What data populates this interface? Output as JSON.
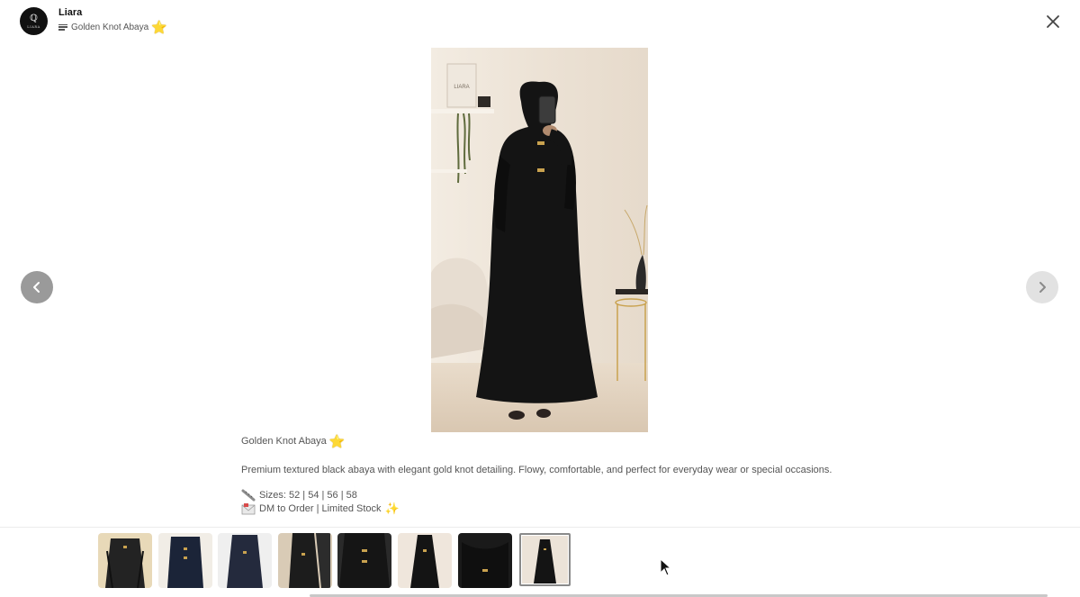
{
  "header": {
    "brand_name": "Liara",
    "avatar_glyph": "ℚ",
    "avatar_text": "LIARA",
    "subtitle": "Golden Knot Abaya",
    "subtitle_star": "⭐",
    "close_icon": "close-icon",
    "menu_icon": "menu-lines-icon"
  },
  "image": {
    "wall_sign": "LIARA"
  },
  "navigation": {
    "prev_icon": "chevron-left-icon",
    "next_icon": "chevron-right-icon"
  },
  "caption": {
    "title": "Golden Knot Abaya",
    "title_star": "⭐",
    "description": "Premium textured black abaya with elegant gold knot detailing. Flowy, comfortable, and perfect for everyday wear or special occasions.",
    "sizes": "Sizes: 52 | 54 | 56 | 58",
    "order": "DM to Order | Limited Stock",
    "sparkle": "✨",
    "sizes_icon": "ruler-icon",
    "order_icon": "envelope-icon"
  },
  "thumbnails": [
    {
      "label": "thumb-1",
      "active": false
    },
    {
      "label": "thumb-2",
      "active": false
    },
    {
      "label": "thumb-3",
      "active": false
    },
    {
      "label": "thumb-4",
      "active": false
    },
    {
      "label": "thumb-5",
      "active": false
    },
    {
      "label": "thumb-6",
      "active": false
    },
    {
      "label": "thumb-7",
      "active": false
    },
    {
      "label": "thumb-8",
      "active": true
    }
  ],
  "colors": {
    "accent_gold": "#f2c230",
    "abaya_black": "#141414",
    "wall_cream": "#efe6dc"
  }
}
